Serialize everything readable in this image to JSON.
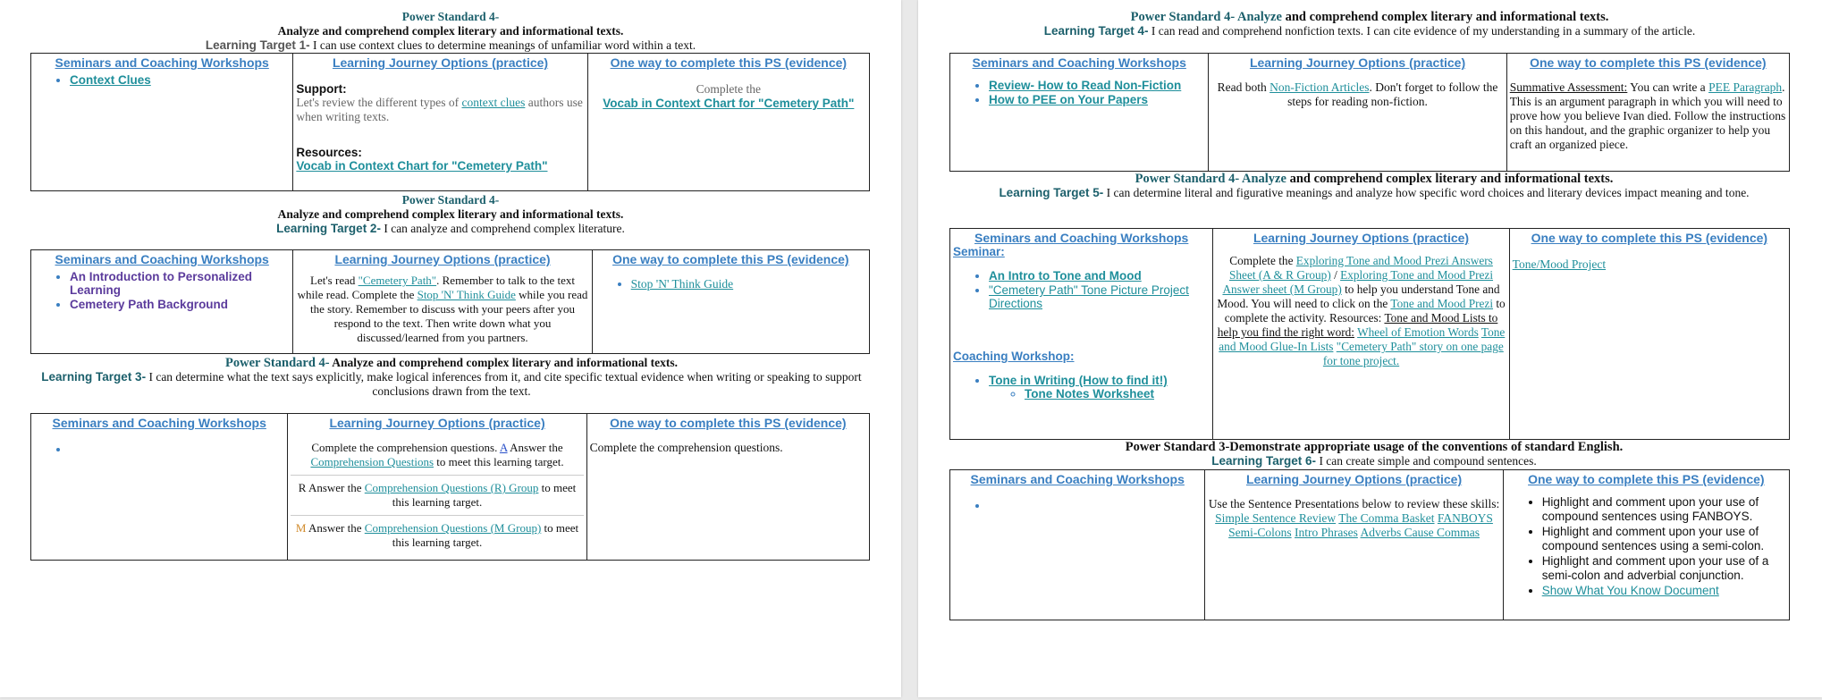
{
  "col_headers": {
    "seminars": "Seminars and Coaching Workshops",
    "journey": "Learning Journey Options (practice)",
    "evidence": "One way to complete this PS (evidence)"
  },
  "page1": {
    "s1": {
      "ps": "Power Standard 4-",
      "ps_text": "Analyze and comprehend complex literary and informational texts.",
      "lt_label": "Learning Target 1-",
      "lt_text": " I can use context clues to determine meanings of unfamiliar word within a text.",
      "seminars": [
        "Context Clues"
      ],
      "support_label": "Support:",
      "support_text_a": "Let's review the different types of ",
      "support_link": "context clues",
      "support_text_b": " authors use when writing texts.",
      "resources_label": "Resources:",
      "resources_link": "Vocab in Context Chart for \"Cemetery Path\"",
      "evidence_text": "Complete the",
      "evidence_link": "Vocab in Context Chart for \"Cemetery Path\""
    },
    "s2": {
      "ps": "Power Standard 4-",
      "ps_text": "Analyze and comprehend complex literary and informational texts.",
      "lt_label": "Learning Target 2-",
      "lt_text": " I can analyze and comprehend complex literature.",
      "seminars": [
        "An Introduction to Personalized Learning",
        "Cemetery Path Background"
      ],
      "j_a": "Let's read ",
      "j_link1": "\"Cemetery Path\"",
      "j_b": ". Remember to talk to the text while read. Complete the ",
      "j_link2": "Stop 'N' Think Guide",
      "j_c": " while you read the story. Remember to discuss with your peers after you respond to the text. Then write down what you discussed/learned from you partners.",
      "evidence_link": "Stop 'N' Think Guide"
    },
    "s3": {
      "ps": "Power Standard 4-",
      "ps_text": " Analyze and comprehend complex literary and informational texts.",
      "lt_label": "Learning Target 3-",
      "lt_text": " I can determine what the text says explicitly, make logical inferences from it, and cite specific textual evidence when writing or speaking to support conclusions drawn from the text.",
      "j1": "Complete the comprehension questions. ",
      "j1_mark": "A",
      "j1_b": " Answer the ",
      "j1_link": "Comprehension Questions",
      "j1_c": " to meet this learning target.",
      "j2_mark": "R",
      "j2_a": " Answer the ",
      "j2_link": "Comprehension Questions (R) Group",
      "j2_b": " to meet this learning target.",
      "j3_mark": "M",
      "j3_a": " Answer the ",
      "j3_link": "Comprehension Questions (M Group)",
      "j3_b": " to meet this learning target.",
      "evidence_text": "Complete the comprehension questions."
    }
  },
  "page2": {
    "s4": {
      "ps": "Power Standard 4- Analyze",
      "ps_text": " and comprehend complex literary and informational texts.",
      "lt_label": "Learning Target 4-",
      "lt_text": " I can read and comprehend nonfiction texts. I can cite evidence of my understanding in a summary of the article.",
      "seminars": [
        "Review- How to Read Non-Fiction",
        "How to PEE on Your Papers"
      ],
      "j_a": "Read both ",
      "j_link": "Non-Fiction Articles",
      "j_b": ". Don't forget to follow the steps for reading non-fiction.",
      "e_label": "Summative Assessment:",
      "e_a": " You can write a ",
      "e_link": "PEE Paragraph",
      "e_b": ". This is an argument paragraph in which you will need to prove how you believe Ivan died. Follow the instructions on this handout, and the graphic organizer to help you craft an organized piece."
    },
    "s5": {
      "ps": "Power Standard 4- Analyze",
      "ps_text": " and comprehend complex literary and informational texts.",
      "lt_label": "Learning Target 5-",
      "lt_text": " I can determine literal and figurative meanings and analyze how specific word choices and literary devices impact meaning and tone.",
      "seminar_label": "Seminar:",
      "seminars": [
        "An Intro to Tone and Mood",
        "\"Cemetery Path\" Tone Picture Project Directions"
      ],
      "coaching_label": "Coaching Workshop:",
      "coaching": [
        "Tone in Writing (How to find it!)"
      ],
      "coaching_sub": [
        "Tone Notes Worksheet"
      ],
      "j_a": "Complete the ",
      "j_link1": "Exploring Tone and Mood Prezi Answers Sheet (A & R Group)",
      "j_sep": " / ",
      "j_link2": "Exploring Tone and Mood Prezi Answer sheet (M Group)",
      "j_b": " to help you understand Tone and Mood. You will need to click on the ",
      "j_link3": "Tone and Mood Prezi",
      "j_c": " to complete the activity. Resources: ",
      "j_link4": "Tone and Mood Lists to help you find the right word:",
      "j_link5": "Wheel of Emotion Words",
      "j_link6": "Tone and Mood Glue-In Lists",
      "j_link7": "\"Cemetery Path\" story on one page for tone project.",
      "evidence_link": "Tone/Mood Project"
    },
    "s6": {
      "ps": "Power Standard 3-Demonstrate appropriate usage of the conventions of standard English.",
      "lt_label": "Learning Target 6-",
      "lt_text": " I can create simple and compound sentences.",
      "j_a": "Use the Sentence Presentations below to review these skills: ",
      "j_links": [
        "Simple Sentence Review",
        "The Comma Basket",
        "FANBOYS",
        "Semi-Colons",
        "Intro Phrases",
        "Adverbs Cause Commas"
      ],
      "evidence": [
        "Highlight and comment upon your use of compound sentences using FANBOYS.",
        "Highlight and comment upon your use of compound sentences using a semi-colon.",
        "Highlight and comment upon your use of a semi-colon and adverbial conjunction."
      ],
      "evidence_link": "Show What You Know Document"
    }
  }
}
